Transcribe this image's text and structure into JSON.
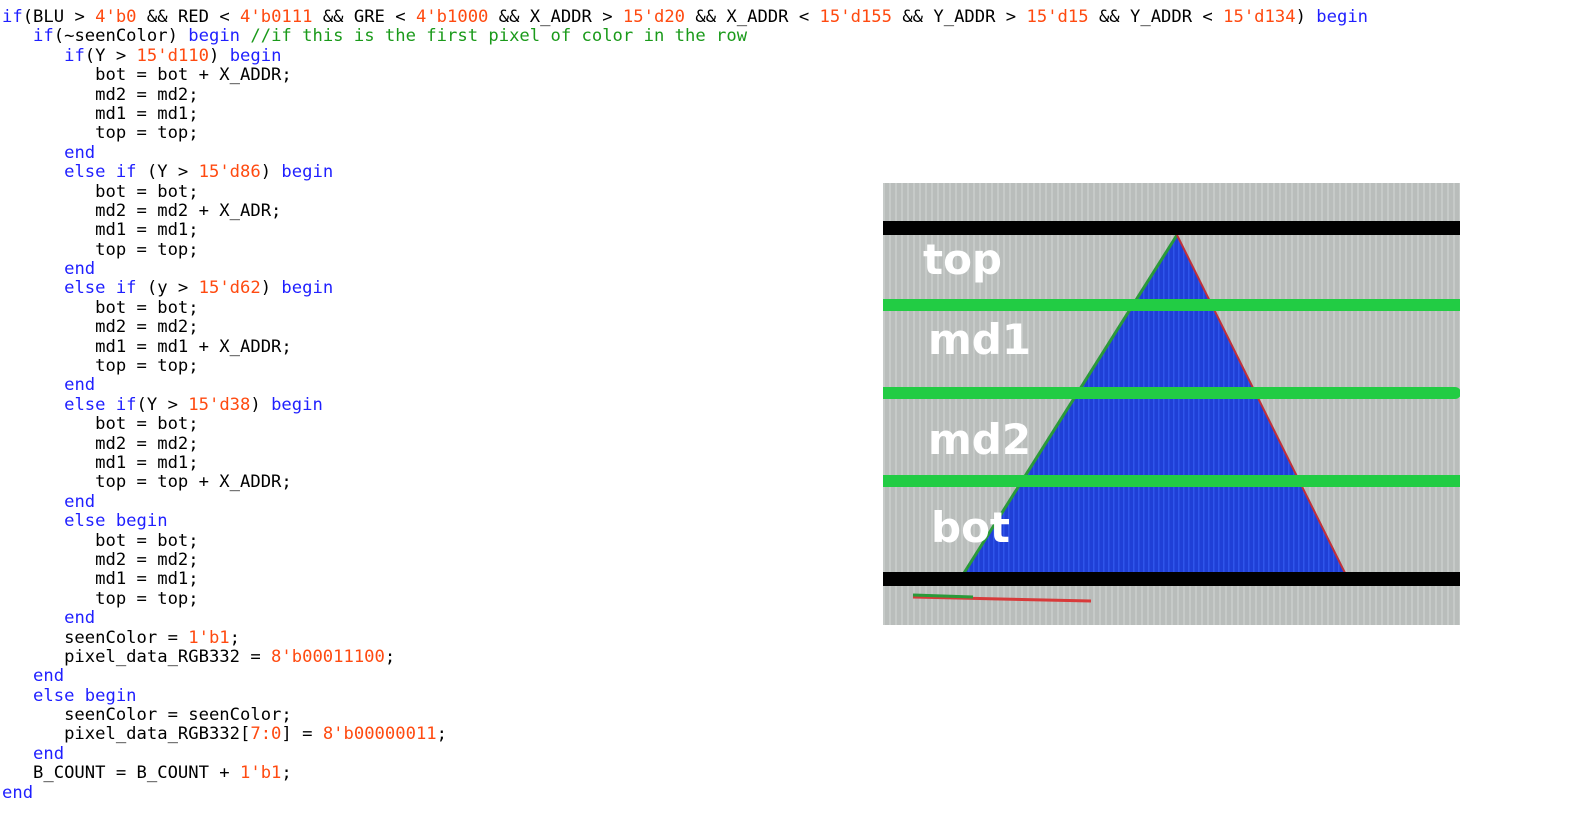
{
  "code_lines": [
    [
      [
        "kw",
        "if"
      ],
      [
        "op",
        "(BLU > "
      ],
      [
        "num",
        "4'b0"
      ],
      [
        "op",
        " && RED < "
      ],
      [
        "num",
        "4'b0111"
      ],
      [
        "op",
        " && GRE < "
      ],
      [
        "num",
        "4'b1000"
      ],
      [
        "op",
        " && X_ADDR > "
      ],
      [
        "num",
        "15'd20"
      ],
      [
        "op",
        " && X_ADDR < "
      ],
      [
        "num",
        "15'd155"
      ],
      [
        "op",
        " && Y_ADDR > "
      ],
      [
        "num",
        "15'd15"
      ],
      [
        "op",
        " && Y_ADDR < "
      ],
      [
        "num",
        "15'd134"
      ],
      [
        "op",
        ") "
      ],
      [
        "kw",
        "begin"
      ]
    ],
    [
      [
        "op",
        "   "
      ],
      [
        "kw",
        "if"
      ],
      [
        "op",
        "(~seenColor) "
      ],
      [
        "kw",
        "begin"
      ],
      [
        "op",
        " "
      ],
      [
        "cm",
        "//if this is the first pixel of color in the row"
      ]
    ],
    [
      [
        "op",
        "      "
      ],
      [
        "kw",
        "if"
      ],
      [
        "op",
        "(Y > "
      ],
      [
        "num",
        "15'd110"
      ],
      [
        "op",
        ") "
      ],
      [
        "kw",
        "begin"
      ]
    ],
    [
      [
        "op",
        "         bot = bot + X_ADDR;"
      ]
    ],
    [
      [
        "op",
        "         md2 = md2;"
      ]
    ],
    [
      [
        "op",
        "         md1 = md1;"
      ]
    ],
    [
      [
        "op",
        "         top = top;"
      ]
    ],
    [
      [
        "op",
        "      "
      ],
      [
        "kw",
        "end"
      ]
    ],
    [
      [
        "op",
        "      "
      ],
      [
        "kw",
        "else if"
      ],
      [
        "op",
        " (Y > "
      ],
      [
        "num",
        "15'd86"
      ],
      [
        "op",
        ") "
      ],
      [
        "kw",
        "begin"
      ]
    ],
    [
      [
        "op",
        "         bot = bot;"
      ]
    ],
    [
      [
        "op",
        "         md2 = md2 + X_ADR;"
      ]
    ],
    [
      [
        "op",
        "         md1 = md1;"
      ]
    ],
    [
      [
        "op",
        "         top = top;"
      ]
    ],
    [
      [
        "op",
        "      "
      ],
      [
        "kw",
        "end"
      ]
    ],
    [
      [
        "op",
        "      "
      ],
      [
        "kw",
        "else if"
      ],
      [
        "op",
        " (y > "
      ],
      [
        "num",
        "15'd62"
      ],
      [
        "op",
        ") "
      ],
      [
        "kw",
        "begin"
      ]
    ],
    [
      [
        "op",
        "         bot = bot;"
      ]
    ],
    [
      [
        "op",
        "         md2 = md2;"
      ]
    ],
    [
      [
        "op",
        "         md1 = md1 + X_ADDR;"
      ]
    ],
    [
      [
        "op",
        "         top = top;"
      ]
    ],
    [
      [
        "op",
        "      "
      ],
      [
        "kw",
        "end"
      ]
    ],
    [
      [
        "op",
        "      "
      ],
      [
        "kw",
        "else if"
      ],
      [
        "op",
        "(Y > "
      ],
      [
        "num",
        "15'd38"
      ],
      [
        "op",
        ") "
      ],
      [
        "kw",
        "begin"
      ]
    ],
    [
      [
        "op",
        "         bot = bot;"
      ]
    ],
    [
      [
        "op",
        "         md2 = md2;"
      ]
    ],
    [
      [
        "op",
        "         md1 = md1;"
      ]
    ],
    [
      [
        "op",
        "         top = top + X_ADDR;"
      ]
    ],
    [
      [
        "op",
        "      "
      ],
      [
        "kw",
        "end"
      ]
    ],
    [
      [
        "op",
        "      "
      ],
      [
        "kw",
        "else begin"
      ]
    ],
    [
      [
        "op",
        "         bot = bot;"
      ]
    ],
    [
      [
        "op",
        "         md2 = md2;"
      ]
    ],
    [
      [
        "op",
        "         md1 = md1;"
      ]
    ],
    [
      [
        "op",
        "         top = top;"
      ]
    ],
    [
      [
        "op",
        "      "
      ],
      [
        "kw",
        "end"
      ]
    ],
    [
      [
        "op",
        "      seenColor = "
      ],
      [
        "num",
        "1'b1"
      ],
      [
        "op",
        ";"
      ]
    ],
    [
      [
        "op",
        "      pixel_data_RGB332 = "
      ],
      [
        "num",
        "8'b00011100"
      ],
      [
        "op",
        ";"
      ]
    ],
    [
      [
        "op",
        "   "
      ],
      [
        "kw",
        "end"
      ]
    ],
    [
      [
        "op",
        "   "
      ],
      [
        "kw",
        "else begin"
      ]
    ],
    [
      [
        "op",
        "      seenColor = seenColor;"
      ]
    ],
    [
      [
        "op",
        "      pixel_data_RGB332["
      ],
      [
        "num",
        "7:0"
      ],
      [
        "op",
        "] = "
      ],
      [
        "num",
        "8'b00000011"
      ],
      [
        "op",
        ";"
      ]
    ],
    [
      [
        "op",
        "   "
      ],
      [
        "kw",
        "end"
      ]
    ],
    [
      [
        "op",
        "   B_COUNT = B_COUNT + "
      ],
      [
        "num",
        "1'b1"
      ],
      [
        "op",
        ";"
      ]
    ],
    [
      [
        "kw",
        "end"
      ]
    ]
  ],
  "photo": {
    "labels": {
      "top": "top",
      "md1": "md1",
      "md2": "md2",
      "bot": "bot"
    },
    "colors": {
      "triangle": "#1f3fd6",
      "band_line_outer": "#000000",
      "band_line_inner": "#22cc44",
      "background": "#b9bdbb"
    }
  }
}
